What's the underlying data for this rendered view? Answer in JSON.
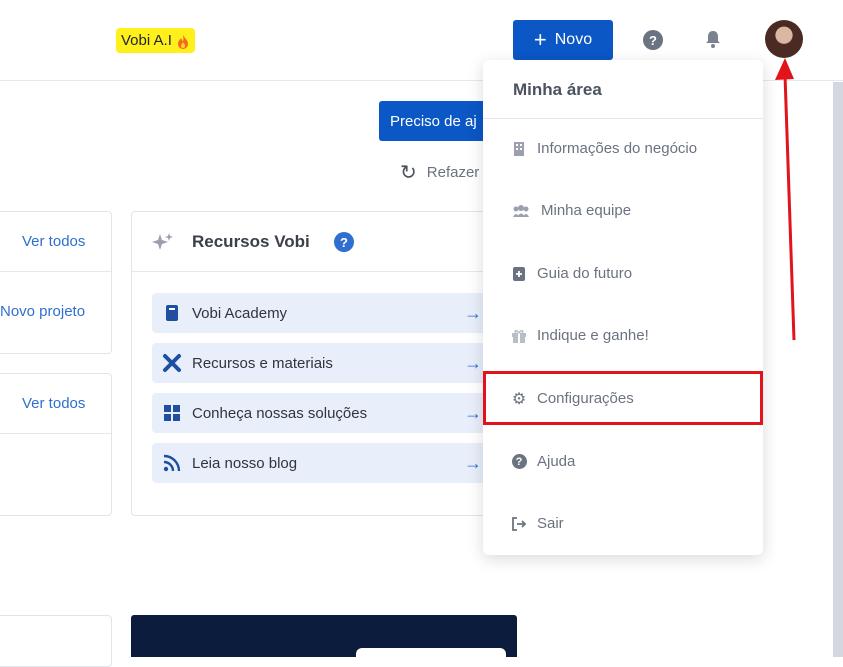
{
  "header": {
    "brand": "Vobi A.I",
    "brand_icon": "fire-icon",
    "new_button": "Novo",
    "new_icon": "plus-icon",
    "help_icon": "question-circle-icon",
    "bell_icon": "bell-icon"
  },
  "main": {
    "help_button": "Preciso de aj",
    "redo": "Refazer",
    "left_card_top": {
      "link": "Ver todos",
      "action": "Novo projeto"
    },
    "left_card_bottom": {
      "link": "Ver todos"
    },
    "resources": {
      "title": "Recursos Vobi",
      "items": [
        {
          "label": "Vobi Academy",
          "icon": "book-icon"
        },
        {
          "label": "Recursos e materiais",
          "icon": "tools-icon"
        },
        {
          "label": "Conheça nossas soluções",
          "icon": "puzzle-icon"
        },
        {
          "label": "Leia nosso blog",
          "icon": "rss-icon"
        }
      ]
    }
  },
  "menu": {
    "title": "Minha área",
    "items": [
      {
        "label": "Informações do negócio",
        "icon": "building-icon"
      },
      {
        "label": "Minha equipe",
        "icon": "team-icon"
      },
      {
        "label": "Guia do futuro",
        "icon": "guide-book-icon"
      },
      {
        "label": "Indique e ganhe!",
        "icon": "gift-icon"
      },
      {
        "label": "Configurações",
        "icon": "gear-icon"
      },
      {
        "label": "Ajuda",
        "icon": "question-circle-icon"
      },
      {
        "label": "Sair",
        "icon": "logout-icon"
      }
    ]
  },
  "colors": {
    "accent": "#0b57c6",
    "highlight": "#e1141b",
    "brand_bg": "#ffef1a"
  }
}
